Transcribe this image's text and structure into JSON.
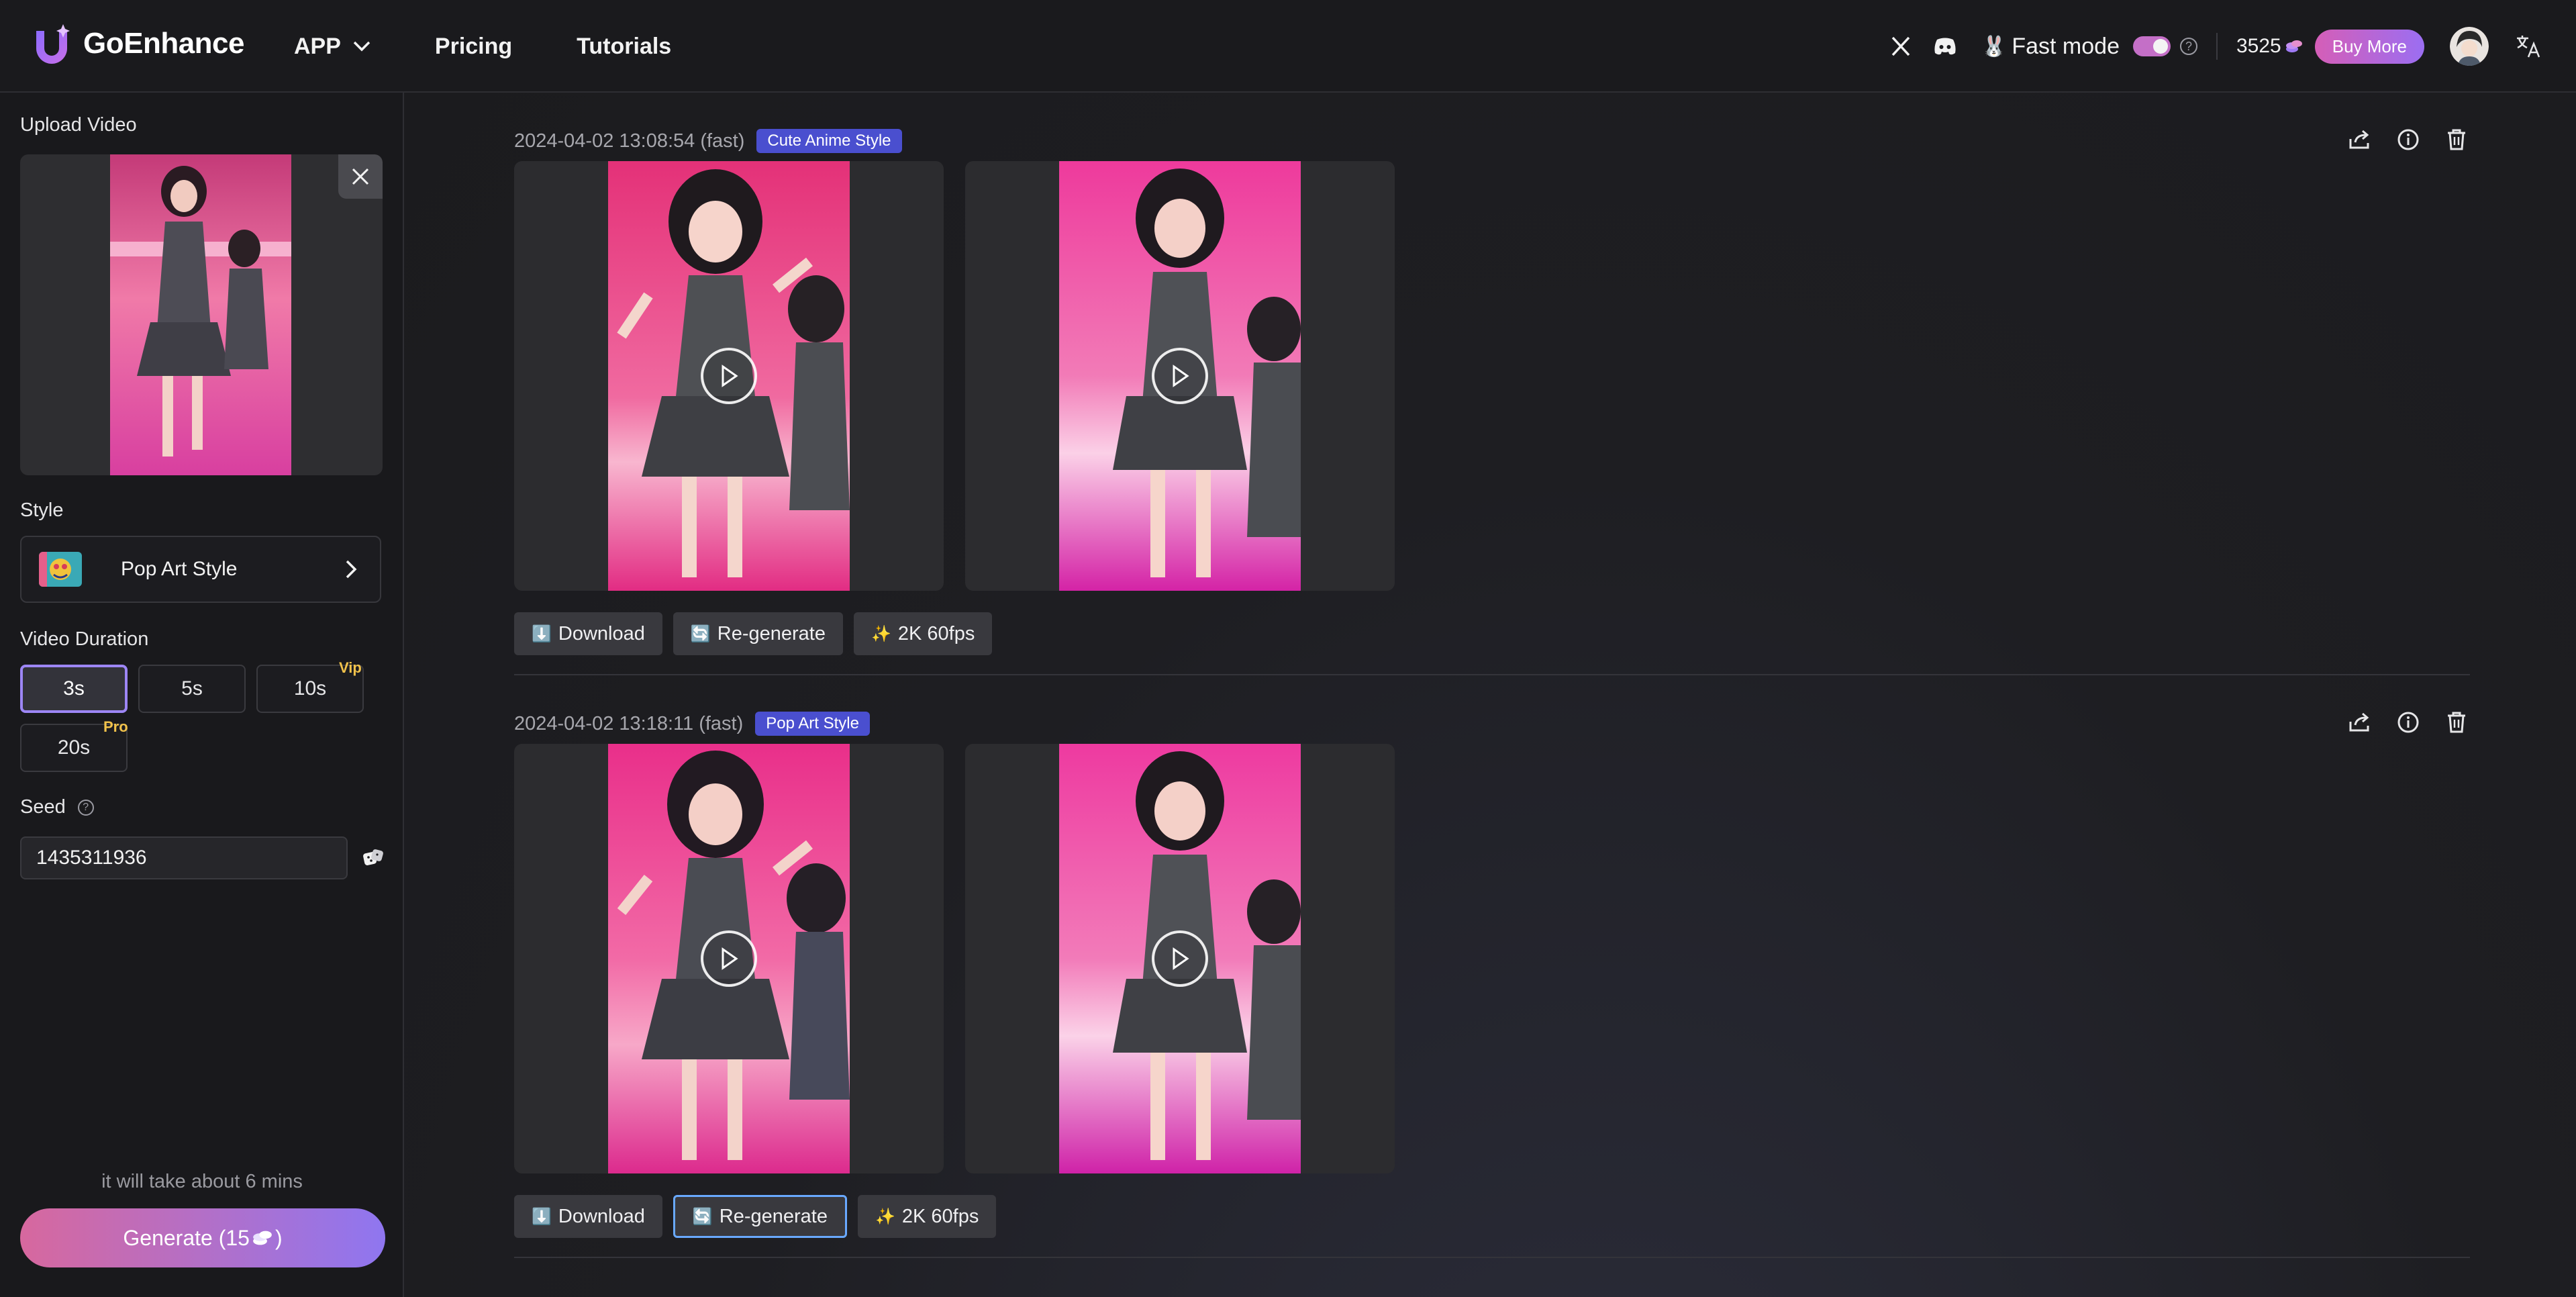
{
  "header": {
    "brand": "GoEnhance",
    "nav": [
      {
        "label": "APP",
        "has_dropdown": true
      },
      {
        "label": "Pricing"
      },
      {
        "label": "Tutorials"
      }
    ],
    "fast_mode_label": "Fast mode",
    "fast_mode_on": true,
    "credits": "3525",
    "buy_more": "Buy More",
    "icons": [
      "x-twitter-icon",
      "discord-icon",
      "bunny-icon",
      "help-icon",
      "coin-icon",
      "avatar",
      "translate-icon"
    ]
  },
  "sidebar": {
    "upload_label": "Upload Video",
    "style_label": "Style",
    "style_value": "Pop Art Style",
    "duration_label": "Video Duration",
    "durations": [
      {
        "label": "3s",
        "active": true,
        "badge": ""
      },
      {
        "label": "5s",
        "active": false,
        "badge": ""
      },
      {
        "label": "10s",
        "active": false,
        "badge": "Vip"
      },
      {
        "label": "20s",
        "active": false,
        "badge": "Pro"
      }
    ],
    "seed_label": "Seed",
    "seed_value": "1435311936",
    "eta": "it will take about 6 mins",
    "generate_label": "Generate (15 ",
    "generate_suffix": ")"
  },
  "tasks": [
    {
      "timestamp": "2024-04-02 13:08:54 (fast)",
      "tag": "Cute Anime Style",
      "buttons": {
        "download": "Download",
        "regenerate": "Re-generate",
        "upscale": "2K 60fps"
      },
      "selected_button": ""
    },
    {
      "timestamp": "2024-04-02 13:18:11 (fast)",
      "tag": "Pop Art Style",
      "buttons": {
        "download": "Download",
        "regenerate": "Re-generate",
        "upscale": "2K 60fps"
      },
      "selected_button": "regenerate"
    }
  ],
  "colors": {
    "accent_purple": "#9d86f5",
    "tag_blue": "#4a4fcf",
    "badge_gold": "#f1c24b",
    "generate_gradient_start": "#d7689e",
    "generate_gradient_end": "#8f76f0"
  }
}
